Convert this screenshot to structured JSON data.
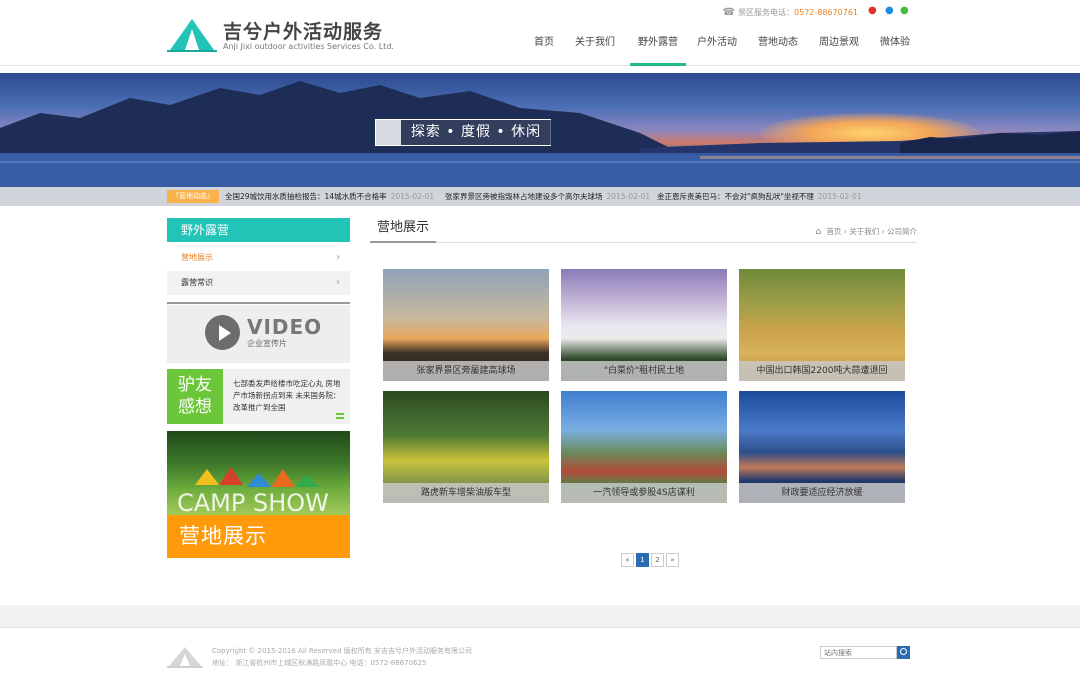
{
  "header": {
    "logo_cn": "吉兮户外活动服务",
    "logo_en": "Anji Jixi outdoor activities Services Co. Ltd.",
    "hotline_label": "景区服务电话：",
    "hotline_number": "0572-88670761",
    "social_icons": [
      "weibo-icon",
      "qq-icon",
      "wechat-icon"
    ],
    "nav": [
      "首页",
      "关于我们",
      "野外露营",
      "户外活动",
      "营地动态",
      "周边景观",
      "微体验"
    ],
    "active_nav": "野外露营"
  },
  "banner": {
    "title": "探索 • 度假 • 休闲"
  },
  "ticker": {
    "label": "『营地动态』",
    "items": [
      {
        "text": "全国29城饮用水质抽检报告：14城水质不合格率",
        "date": "2015-02-01"
      },
      {
        "text": "张家界景区旁被指毁林占地建设多个高尔夫球场",
        "date": "2015-02-01"
      },
      {
        "text": "金正恩斥责美巴马：不会对\"疯狗乱吠\"坐视不理",
        "date": "2015-02-01"
      }
    ]
  },
  "sidebar": {
    "heading": "野外露营",
    "items": [
      {
        "label": "营地展示",
        "active": true
      },
      {
        "label": "露营常识",
        "active": false
      }
    ],
    "video": {
      "big": "VIDEO",
      "small": "企业宣传片"
    },
    "friend": {
      "tag_line1": "驴友",
      "tag_line2": "感想",
      "text": "七部委发声给楼市吃定心丸 房地产市场新拐点到来 未来国务院：改革推广到全国"
    },
    "camp": {
      "en": "CAMP SHOW",
      "cn": "营地展示"
    }
  },
  "main": {
    "title": "营地展示",
    "breadcrumb": [
      "首页",
      "关于我们",
      "公司简介"
    ],
    "cards": [
      {
        "caption": "张家界景区旁屡建高球场"
      },
      {
        "caption": "\"白菜价\"租村民土地"
      },
      {
        "caption": "中国出口韩国2200吨大蒜遭退回"
      },
      {
        "caption": "路虎新车增柴油版车型"
      },
      {
        "caption": "一汽领导或参股4S店谋利"
      },
      {
        "caption": "财政要适应经济放缓"
      }
    ]
  },
  "pager": {
    "prev": "«",
    "pages": [
      "1",
      "2"
    ],
    "current": "1",
    "next": "»"
  },
  "footer": {
    "line1": "Copyright © 2015-2016 All Reserved 版权所有 安吉吉兮户外活动服务有限公司",
    "line2": "地址： 浙江省杭州市上城区秋涛路凤凰中心    电话：0572-88670625",
    "search_placeholder": "站内搜索"
  },
  "colors": {
    "accent": "#22c4b8",
    "nav_active": "#22b98f",
    "orange": "#ff9a0b",
    "green": "#6cc63a",
    "link_blue": "#2b6db0"
  }
}
